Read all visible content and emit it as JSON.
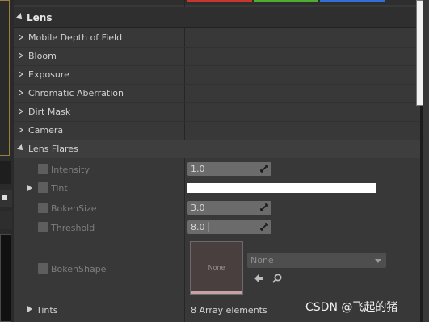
{
  "section": {
    "title": "Lens"
  },
  "categories": [
    {
      "label": "Mobile Depth of Field"
    },
    {
      "label": "Bloom"
    },
    {
      "label": "Exposure"
    },
    {
      "label": "Chromatic Aberration"
    },
    {
      "label": "Dirt Mask"
    },
    {
      "label": "Camera"
    }
  ],
  "lens_flares": {
    "label": "Lens Flares",
    "intensity": {
      "label": "Intensity",
      "value": "1.0"
    },
    "tint": {
      "label": "Tint",
      "color": "#ffffff"
    },
    "bokeh_size": {
      "label": "BokehSize",
      "value": "3.0"
    },
    "threshold": {
      "label": "Threshold",
      "value": "8.0"
    },
    "bokeh_shape": {
      "label": "BokehShape",
      "thumbnail_text": "None",
      "selected": "None"
    },
    "tints": {
      "label": "Tints",
      "value": "8 Array elements"
    }
  },
  "top_swatches": [
    "#c8362e",
    "#4caf2f",
    "#2f6fd6"
  ],
  "watermark": "CSDN @飞起的猪"
}
